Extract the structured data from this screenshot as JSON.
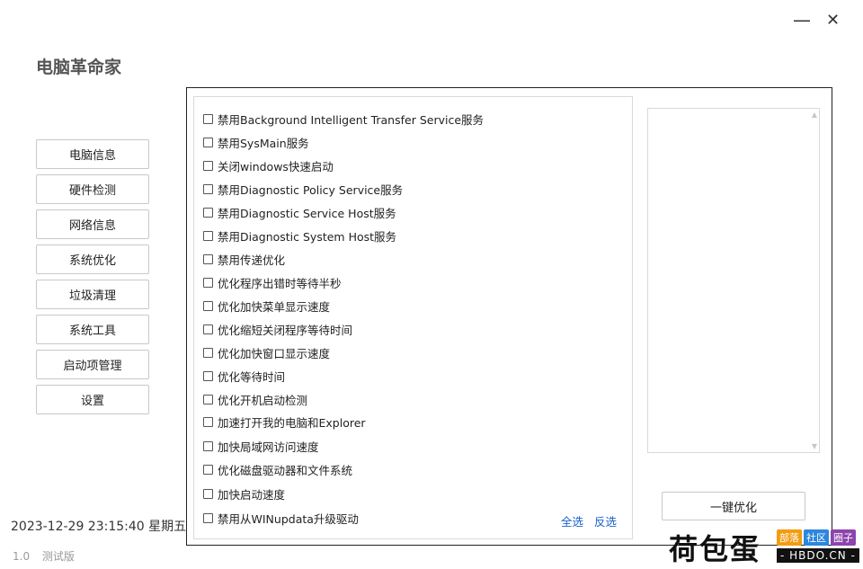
{
  "window": {
    "minimize_glyph": "—",
    "close_glyph": "✕"
  },
  "app_title": "电脑革命家",
  "nav": [
    {
      "label": "电脑信息"
    },
    {
      "label": "硬件检测"
    },
    {
      "label": "网络信息"
    },
    {
      "label": "系统优化"
    },
    {
      "label": "垃圾清理"
    },
    {
      "label": "系统工具"
    },
    {
      "label": "启动项管理"
    },
    {
      "label": "设置"
    }
  ],
  "datetime": "2023-12-29 23:15:40  星期五",
  "version": {
    "number": "1.0",
    "label": "测试版"
  },
  "options": [
    {
      "label": "禁用Background Intelligent Transfer Service服务",
      "checked": false
    },
    {
      "label": "禁用SysMain服务",
      "checked": false
    },
    {
      "label": "关闭windows快速启动",
      "checked": false
    },
    {
      "label": "禁用Diagnostic Policy Service服务",
      "checked": false
    },
    {
      "label": "禁用Diagnostic Service Host服务",
      "checked": false
    },
    {
      "label": "禁用Diagnostic System Host服务",
      "checked": false
    },
    {
      "label": "禁用传递优化",
      "checked": false
    },
    {
      "label": "优化程序出错时等待半秒",
      "checked": false
    },
    {
      "label": "优化加快菜单显示速度",
      "checked": false
    },
    {
      "label": "优化缩短关闭程序等待时间",
      "checked": false
    },
    {
      "label": "优化加快窗口显示速度",
      "checked": false
    },
    {
      "label": "优化等待时间",
      "checked": false
    },
    {
      "label": "优化开机启动检测",
      "checked": false
    },
    {
      "label": "加速打开我的电脑和Explorer",
      "checked": false
    },
    {
      "label": "加快局域网访问速度",
      "checked": false
    },
    {
      "label": "优化磁盘驱动器和文件系统",
      "checked": false
    },
    {
      "label": "加快启动速度",
      "checked": false
    },
    {
      "label": "禁用从WINupdata升级驱动",
      "checked": false
    }
  ],
  "select_all_label": "全选",
  "invert_label": "反选",
  "optimize_button_label": "一键优化",
  "watermark": {
    "main": "荷包蛋",
    "tags": [
      {
        "text": "部落",
        "color": "#f39c12"
      },
      {
        "text": "社区",
        "color": "#2e86de"
      },
      {
        "text": "圈子",
        "color": "#8e44ad"
      }
    ],
    "url": "- HBDO.CN -"
  },
  "colors": {
    "link": "#1a63c6",
    "border": "#c8c8c8"
  }
}
